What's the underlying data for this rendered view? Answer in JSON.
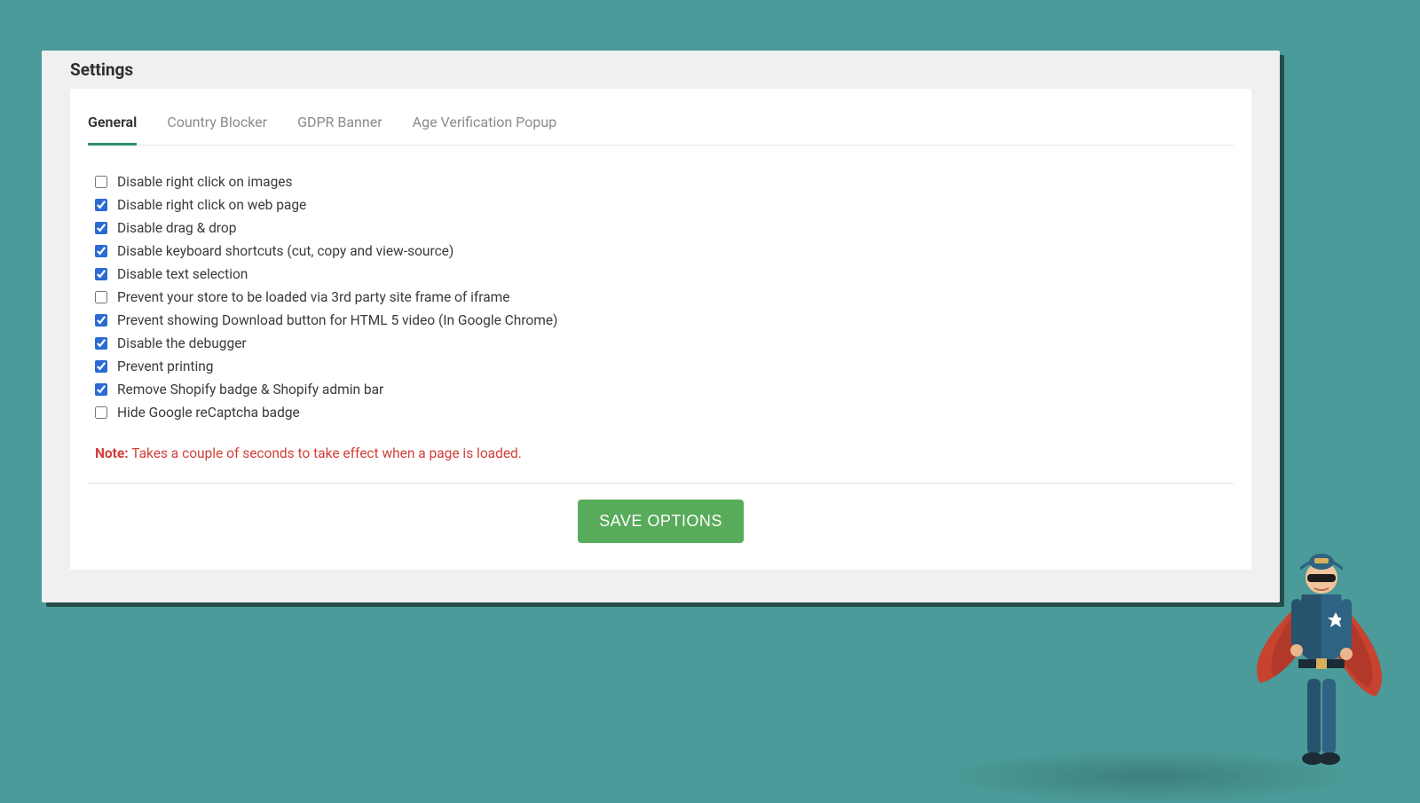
{
  "page_title": "Settings",
  "tabs": [
    {
      "label": "General",
      "active": true
    },
    {
      "label": "Country Blocker",
      "active": false
    },
    {
      "label": "GDPR Banner",
      "active": false
    },
    {
      "label": "Age Verification Popup",
      "active": false
    }
  ],
  "options": [
    {
      "label": "Disable right click on images",
      "checked": false
    },
    {
      "label": "Disable right click on web page",
      "checked": true
    },
    {
      "label": "Disable drag & drop",
      "checked": true
    },
    {
      "label": "Disable keyboard shortcuts (cut, copy and view-source)",
      "checked": true
    },
    {
      "label": "Disable text selection",
      "checked": true
    },
    {
      "label": "Prevent your store to be loaded via 3rd party site frame of iframe",
      "checked": false
    },
    {
      "label": "Prevent showing Download button for HTML 5 video (In Google Chrome)",
      "checked": true
    },
    {
      "label": "Disable the debugger",
      "checked": true
    },
    {
      "label": "Prevent printing",
      "checked": true
    },
    {
      "label": "Remove Shopify badge & Shopify admin bar",
      "checked": true
    },
    {
      "label": "Hide Google reCaptcha badge",
      "checked": false
    }
  ],
  "note": {
    "label": "Note:",
    "text": " Takes a couple of seconds to take effect when a page is loaded."
  },
  "save_button": "SAVE OPTIONS"
}
